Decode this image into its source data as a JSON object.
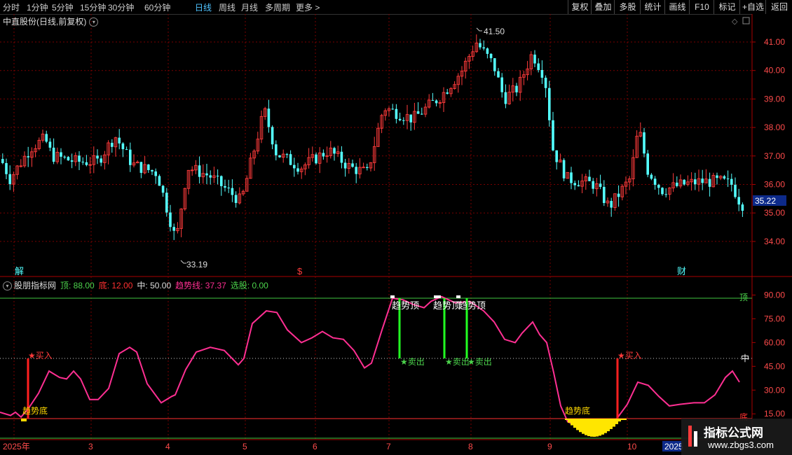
{
  "toolbar": {
    "periods": [
      "分时",
      "1分钟",
      "5分钟",
      "15分钟",
      "30分钟",
      "60分钟",
      "日线",
      "周线",
      "月线",
      "多周期",
      "更多 >"
    ],
    "active_period": "日线",
    "right_buttons": [
      "复权",
      "叠加",
      "多股",
      "统计",
      "画线",
      "F10",
      "标记",
      "+自选",
      "返回"
    ]
  },
  "stock": {
    "title": "中直股份(日线,前复权)"
  },
  "price_axis": {
    "labels": [
      "41.00",
      "40.00",
      "39.00",
      "38.00",
      "37.00",
      "36.00",
      "35.00",
      "34.00"
    ],
    "current": "35.22"
  },
  "annotations": {
    "high": "41.50",
    "low": "33.19"
  },
  "event_markers": [
    "解",
    "$",
    "财"
  ],
  "indicator": {
    "name": "股朋指标网",
    "params": [
      {
        "label": "顶: 88.00",
        "color": "#4cd44c"
      },
      {
        "label": "底: 12.00",
        "color": "#ff3030"
      },
      {
        "label": "中: 50.00",
        "color": "#dddddd"
      },
      {
        "label": "趋势线: 37.37",
        "color": "#ff2f92"
      },
      {
        "label": "选股: 0.00",
        "color": "#4cd44c"
      }
    ],
    "axis_labels": [
      "90.00",
      "75.00",
      "60.00",
      "45.00",
      "30.00",
      "15.00"
    ],
    "side_labels": {
      "top": "顶",
      "mid": "中",
      "bottom": "底"
    },
    "signals": {
      "buy": "★买入",
      "sell": "★卖出",
      "trend_top": "趋势顶",
      "trend_bottom": "趋势底"
    }
  },
  "date_axis": [
    "2025年",
    "3",
    "4",
    "5",
    "6",
    "7",
    "8",
    "9",
    "10",
    "2025"
  ],
  "watermark": {
    "title": "指标公式网",
    "url": "www.zbgs3.com"
  },
  "colors": {
    "up": "#ff3b3b",
    "down": "#54ffff",
    "trend": "#ff2f92",
    "grid": "#7a0000"
  }
}
